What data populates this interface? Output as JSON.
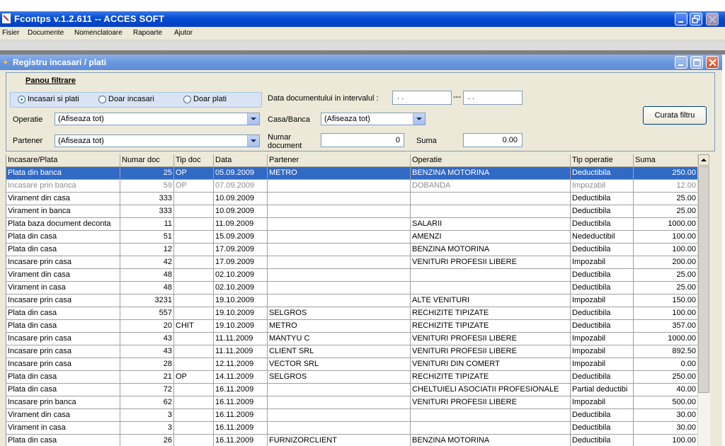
{
  "app": {
    "title": "Fcontps v.1.2.611 -- ACCES SOFT"
  },
  "menu": [
    "Fisier",
    "Documente",
    "Nomenclatoare",
    "Rapoarte",
    "Ajutor"
  ],
  "window": {
    "title": "Registru incasari / plati"
  },
  "filter": {
    "panel_title": "Panou filtrare",
    "radios": [
      "Incasari si plati",
      "Doar incasari",
      "Doar plati"
    ],
    "selected_radio": "Incasari si plati",
    "date_label": "Data documentului in intervalul :",
    "date_from": " .  .",
    "date_sep": "---",
    "date_to": " .  .",
    "operatie_label": "Operatie",
    "operatie_value": "(Afiseaza tot)",
    "casa_label": "Casa/Banca",
    "casa_value": "(Afiseaza tot)",
    "partener_label": "Partener",
    "partener_value": "(Afiseaza tot)",
    "numar_label": "Numar document",
    "numar_value": "0",
    "suma_label": "Suma",
    "suma_value": "0.00",
    "clear_button": "Curata filtru"
  },
  "grid": {
    "columns": [
      "Incasare/Plata",
      "Numar doc",
      "Tip doc",
      "Data",
      "Partener",
      "Operatie",
      "Tip operatie",
      "Suma"
    ],
    "selected_row": 0,
    "dimmed_rows": [
      1
    ],
    "rows": [
      [
        "Plata din banca",
        "25",
        "OP",
        "05.09.2009",
        "METRO",
        "BENZINA  MOTORINA",
        "Deductibila",
        "250.00"
      ],
      [
        "Incasare prin banca",
        "59",
        "OP",
        "07.09.2009",
        "",
        "DOBANDA",
        "Impozabil",
        "12.00"
      ],
      [
        "Virament din casa",
        "333",
        "",
        "10.09.2009",
        "",
        "",
        "Deductibila",
        "25.00"
      ],
      [
        "Virament in banca",
        "333",
        "",
        "10.09.2009",
        "",
        "",
        "Deductibila",
        "25.00"
      ],
      [
        "Plata baza document deconta",
        "11",
        "",
        "11.09.2009",
        "",
        "SALARII",
        "Deductibila",
        "1000.00"
      ],
      [
        "Plata din casa",
        "51",
        "",
        "15.09.2009",
        "",
        "AMENZI",
        "Nedeductibil",
        "100.00"
      ],
      [
        "Plata din casa",
        "12",
        "",
        "17.09.2009",
        "",
        "BENZINA  MOTORINA",
        "Deductibila",
        "100.00"
      ],
      [
        "Incasare prin casa",
        "42",
        "",
        "17.09.2009",
        "",
        "VENITURI PROFESII LIBERE",
        "Impozabil",
        "200.00"
      ],
      [
        "Virament din casa",
        "48",
        "",
        "02.10.2009",
        "",
        "",
        "Deductibila",
        "25.00"
      ],
      [
        "Virament in casa",
        "48",
        "",
        "02.10.2009",
        "",
        "",
        "Deductibila",
        "25.00"
      ],
      [
        "Incasare prin casa",
        "3231",
        "",
        "19.10.2009",
        "",
        "ALTE VENITURI",
        "Impozabil",
        "150.00"
      ],
      [
        "Plata din casa",
        "557",
        "",
        "19.10.2009",
        "SELGROS",
        "RECHIZITE  TIPIZATE",
        "Deductibila",
        "100.00"
      ],
      [
        "Plata din casa",
        "20",
        "CHIT",
        "19.10.2009",
        "METRO",
        "RECHIZITE  TIPIZATE",
        "Deductibila",
        "357.00"
      ],
      [
        "Incasare prin casa",
        "43",
        "",
        "11.11.2009",
        "MANTYU C",
        "VENITURI PROFESII LIBERE",
        "Impozabil",
        "1000.00"
      ],
      [
        "Incasare prin casa",
        "43",
        "",
        "11.11.2009",
        "CLIENT SRL",
        "VENITURI PROFESII LIBERE",
        "Impozabil",
        "892.50"
      ],
      [
        "Incasare prin casa",
        "28",
        "",
        "12.11.2009",
        "VECTOR  SRL",
        "VENITURI DIN COMERT",
        "Impozabil",
        "0.00"
      ],
      [
        "Plata din casa",
        "21",
        "OP",
        "14.11.2009",
        "SELGROS",
        "RECHIZITE  TIPIZATE",
        "Deductibila",
        "250.00"
      ],
      [
        "Plata din casa",
        "72",
        "",
        "16.11.2009",
        "",
        "CHELTUIELI ASOCIATII PROFESIONALE",
        "Partial deductibi",
        "40.00"
      ],
      [
        "Incasare prin banca",
        "62",
        "",
        "16.11.2009",
        "",
        "VENITURI PROFESII LIBERE",
        "Impozabil",
        "500.00"
      ],
      [
        "Virament din casa",
        "3",
        "",
        "16.11.2009",
        "",
        "",
        "Deductibila",
        "30.00"
      ],
      [
        "Virament in casa",
        "3",
        "",
        "16.11.2009",
        "",
        "",
        "Deductibila",
        "30.00"
      ],
      [
        "Plata din casa",
        "26",
        "",
        "16.11.2009",
        "FURNIZORCLIENT",
        "BENZINA  MOTORINA",
        "Deductibila",
        "100.00"
      ]
    ]
  }
}
